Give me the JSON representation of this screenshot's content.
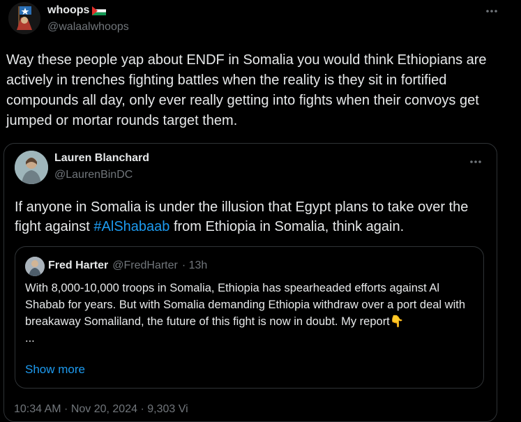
{
  "tweet": {
    "display_name": "whoops",
    "handle": "@walaalwhoops",
    "text": "Way these people yap about ENDF in Somalia you would think Ethiopians are actively in trenches fighting battles when the reality is they sit in fortified compounds all day, only ever really getting into fights when their convoys get jumped or mortar rounds target them.",
    "more_icon": "ellipsis-icon",
    "flag_icon": "palestine-flag-icon"
  },
  "quote": {
    "display_name": "Lauren Blanchard",
    "handle": "@LaurenBinDC",
    "text_before": "If anyone in Somalia is under the illusion that Egypt plans to take over the fight against ",
    "hashtag": "#AlShabaab",
    "text_after": " from Ethiopia in Somalia, think again.",
    "footer_partial": "10:34 AM · Nov 20, 2024 · 9,303 Vi",
    "more_icon": "ellipsis-icon"
  },
  "nested_quote": {
    "display_name": "Fred Harter",
    "handle": "@FredHarter",
    "time": "· 13h",
    "text": "With 8,000-10,000 troops in Somalia, Ethiopia has spearheaded efforts against Al Shabab for years. But with Somalia demanding Ethiopia withdraw over a port deal with breakaway Somaliland, the future of this fight is now in doubt. My report",
    "emoji": "👇",
    "ellipsis": "...",
    "show_more": "Show more"
  },
  "colors": {
    "background": "#000000",
    "text": "#e7e9ea",
    "secondary": "#71767b",
    "link": "#1d9bf0",
    "border": "#2f3336"
  }
}
